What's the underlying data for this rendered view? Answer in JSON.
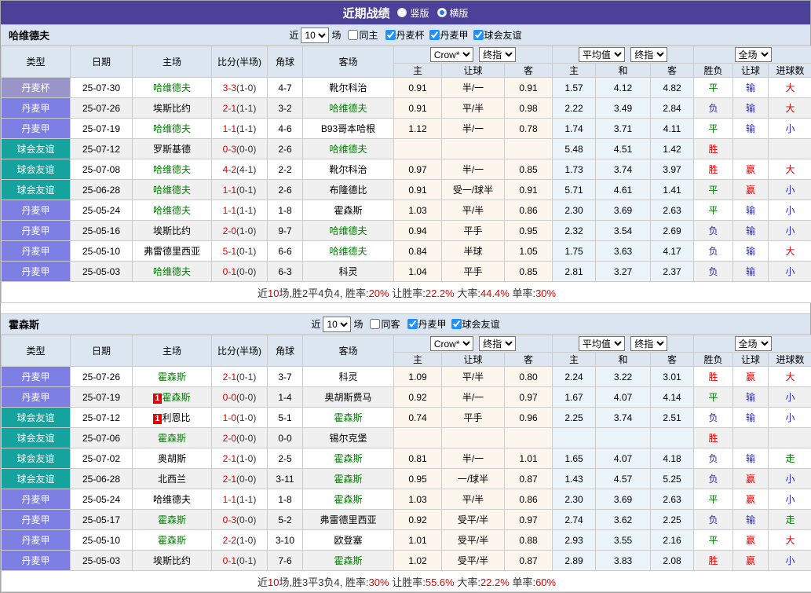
{
  "title_bar": {
    "title": "近期战绩",
    "radio_vertical": "竖版",
    "radio_horizontal": "横版",
    "selected": "横版"
  },
  "header_labels": {
    "type": "类型",
    "date": "日期",
    "home": "主场",
    "score": "比分(半场)",
    "corner": "角球",
    "away": "客场",
    "crow_select": "Crow*",
    "final_select": "终指",
    "avg_select": "平均值",
    "full_select": "全场",
    "odds_home": "主",
    "odds_handicap": "让球",
    "odds_away": "客",
    "avg_home": "主",
    "avg_draw": "和",
    "avg_away": "客",
    "result": "胜负",
    "handicap_result": "让球",
    "goals": "进球数"
  },
  "colors": {
    "accent_purple": "#4c4199",
    "cup": "#9a95c9",
    "league": "#7e7fe4",
    "friendly": "#15a3a0",
    "team_green": "#008000",
    "score_red": "#e00000",
    "loss_blue": "#2626d8"
  },
  "sections": [
    {
      "team": "哈维德夫",
      "filter": {
        "prefix": "近",
        "count": "10",
        "suffix": "场",
        "same_label": "同主",
        "same_checked": false,
        "leagues": [
          {
            "label": "丹麦杯",
            "checked": true
          },
          {
            "label": "丹麦甲",
            "checked": true
          },
          {
            "label": "球会友谊",
            "checked": true
          }
        ]
      },
      "rows": [
        {
          "type": "丹麦杯",
          "cls": "t-cup",
          "date": "25-07-30",
          "home": "哈维德夫",
          "hg": true,
          "hb": "",
          "score": "3-3",
          "half": "(1-0)",
          "corner": "4-7",
          "away": "靴尔科治",
          "ag": false,
          "ab": "",
          "crow": [
            "0.91",
            "半/一",
            "0.91"
          ],
          "avg": [
            "1.57",
            "4.12",
            "4.82"
          ],
          "res": [
            [
              "平",
              "g"
            ],
            [
              "输",
              "b"
            ],
            [
              "大",
              "r"
            ]
          ]
        },
        {
          "type": "丹麦甲",
          "cls": "t-league",
          "date": "25-07-26",
          "home": "埃斯比约",
          "hg": false,
          "hb": "",
          "score": "2-1",
          "half": "(1-1)",
          "corner": "3-2",
          "away": "哈维德夫",
          "ag": true,
          "ab": "",
          "crow": [
            "0.91",
            "平/半",
            "0.98"
          ],
          "avg": [
            "2.22",
            "3.49",
            "2.84"
          ],
          "res": [
            [
              "负",
              "b"
            ],
            [
              "输",
              "b"
            ],
            [
              "大",
              "r"
            ]
          ]
        },
        {
          "type": "丹麦甲",
          "cls": "t-league",
          "date": "25-07-19",
          "home": "哈维德夫",
          "hg": true,
          "hb": "",
          "score": "1-1",
          "half": "(1-1)",
          "corner": "4-6",
          "away": "B93哥本哈根",
          "ag": false,
          "ab": "",
          "crow": [
            "1.12",
            "半/一",
            "0.78"
          ],
          "avg": [
            "1.74",
            "3.71",
            "4.11"
          ],
          "res": [
            [
              "平",
              "g"
            ],
            [
              "输",
              "b"
            ],
            [
              "小",
              "b"
            ]
          ]
        },
        {
          "type": "球会友谊",
          "cls": "t-friendly",
          "date": "25-07-12",
          "home": "罗斯基德",
          "hg": false,
          "hb": "",
          "score": "0-3",
          "half": "(0-0)",
          "corner": "2-6",
          "away": "哈维德夫",
          "ag": true,
          "ab": "",
          "crow": [
            "",
            "",
            ""
          ],
          "avg": [
            "5.48",
            "4.51",
            "1.42"
          ],
          "res": [
            [
              "胜",
              "r"
            ],
            [
              "",
              ""
            ],
            [
              "",
              ""
            ]
          ]
        },
        {
          "type": "球会友谊",
          "cls": "t-friendly",
          "date": "25-07-08",
          "home": "哈维德夫",
          "hg": true,
          "hb": "",
          "score": "4-2",
          "half": "(4-1)",
          "corner": "2-2",
          "away": "靴尔科治",
          "ag": false,
          "ab": "",
          "crow": [
            "0.97",
            "半/一",
            "0.85"
          ],
          "avg": [
            "1.73",
            "3.74",
            "3.97"
          ],
          "res": [
            [
              "胜",
              "r"
            ],
            [
              "赢",
              "r"
            ],
            [
              "大",
              "r"
            ]
          ]
        },
        {
          "type": "球会友谊",
          "cls": "t-friendly",
          "date": "25-06-28",
          "home": "哈维德夫",
          "hg": true,
          "hb": "",
          "score": "1-1",
          "half": "(0-1)",
          "corner": "2-6",
          "away": "布隆德比",
          "ag": false,
          "ab": "",
          "crow": [
            "0.91",
            "受一/球半",
            "0.91"
          ],
          "avg": [
            "5.71",
            "4.61",
            "1.41"
          ],
          "res": [
            [
              "平",
              "g"
            ],
            [
              "赢",
              "r"
            ],
            [
              "小",
              "b"
            ]
          ]
        },
        {
          "type": "丹麦甲",
          "cls": "t-league",
          "date": "25-05-24",
          "home": "哈维德夫",
          "hg": true,
          "hb": "",
          "score": "1-1",
          "half": "(1-1)",
          "corner": "1-8",
          "away": "霍森斯",
          "ag": false,
          "ab": "",
          "crow": [
            "1.03",
            "平/半",
            "0.86"
          ],
          "avg": [
            "2.30",
            "3.69",
            "2.63"
          ],
          "res": [
            [
              "平",
              "g"
            ],
            [
              "输",
              "b"
            ],
            [
              "小",
              "b"
            ]
          ]
        },
        {
          "type": "丹麦甲",
          "cls": "t-league",
          "date": "25-05-16",
          "home": "埃斯比约",
          "hg": false,
          "hb": "",
          "score": "2-0",
          "half": "(1-0)",
          "corner": "9-7",
          "away": "哈维德夫",
          "ag": true,
          "ab": "",
          "crow": [
            "0.94",
            "平手",
            "0.95"
          ],
          "avg": [
            "2.32",
            "3.54",
            "2.69"
          ],
          "res": [
            [
              "负",
              "b"
            ],
            [
              "输",
              "b"
            ],
            [
              "小",
              "b"
            ]
          ]
        },
        {
          "type": "丹麦甲",
          "cls": "t-league",
          "date": "25-05-10",
          "home": "弗雷德里西亚",
          "hg": false,
          "hb": "",
          "score": "5-1",
          "half": "(0-1)",
          "corner": "6-6",
          "away": "哈维德夫",
          "ag": true,
          "ab": "",
          "crow": [
            "0.84",
            "半球",
            "1.05"
          ],
          "avg": [
            "1.75",
            "3.63",
            "4.17"
          ],
          "res": [
            [
              "负",
              "b"
            ],
            [
              "输",
              "b"
            ],
            [
              "大",
              "r"
            ]
          ]
        },
        {
          "type": "丹麦甲",
          "cls": "t-league",
          "date": "25-05-03",
          "home": "哈维德夫",
          "hg": true,
          "hb": "",
          "score": "0-1",
          "half": "(0-0)",
          "corner": "6-3",
          "away": "科灵",
          "ag": false,
          "ab": "",
          "crow": [
            "1.04",
            "平手",
            "0.85"
          ],
          "avg": [
            "2.81",
            "3.27",
            "2.37"
          ],
          "res": [
            [
              "负",
              "b"
            ],
            [
              "输",
              "b"
            ],
            [
              "小",
              "b"
            ]
          ]
        }
      ],
      "summary": [
        {
          "t": "近",
          "c": "k"
        },
        {
          "t": "10",
          "c": "r"
        },
        {
          "t": "场,胜2平4负4, 胜率:",
          "c": "k"
        },
        {
          "t": "20%",
          "c": "r"
        },
        {
          "t": " 让胜率:",
          "c": "k"
        },
        {
          "t": "22.2%",
          "c": "r"
        },
        {
          "t": " 大率:",
          "c": "k"
        },
        {
          "t": "44.4%",
          "c": "r"
        },
        {
          "t": " 单率:",
          "c": "k"
        },
        {
          "t": "30%",
          "c": "r"
        }
      ]
    },
    {
      "team": "霍森斯",
      "filter": {
        "prefix": "近",
        "count": "10",
        "suffix": "场",
        "same_label": "同客",
        "same_checked": false,
        "leagues": [
          {
            "label": "丹麦甲",
            "checked": true
          },
          {
            "label": "球会友谊",
            "checked": true
          }
        ]
      },
      "rows": [
        {
          "type": "丹麦甲",
          "cls": "t-league",
          "date": "25-07-26",
          "home": "霍森斯",
          "hg": true,
          "hb": "",
          "score": "2-1",
          "half": "(0-1)",
          "corner": "3-7",
          "away": "科灵",
          "ag": false,
          "ab": "",
          "crow": [
            "1.09",
            "平/半",
            "0.80"
          ],
          "avg": [
            "2.24",
            "3.22",
            "3.01"
          ],
          "res": [
            [
              "胜",
              "r"
            ],
            [
              "赢",
              "r"
            ],
            [
              "大",
              "r"
            ]
          ]
        },
        {
          "type": "丹麦甲",
          "cls": "t-league",
          "date": "25-07-19",
          "home": "霍森斯",
          "hg": true,
          "hb": "1",
          "score": "0-0",
          "half": "(0-0)",
          "corner": "1-4",
          "away": "奥胡斯费马",
          "ag": false,
          "ab": "",
          "crow": [
            "0.92",
            "半/一",
            "0.97"
          ],
          "avg": [
            "1.67",
            "4.07",
            "4.14"
          ],
          "res": [
            [
              "平",
              "g"
            ],
            [
              "输",
              "b"
            ],
            [
              "小",
              "b"
            ]
          ]
        },
        {
          "type": "球会友谊",
          "cls": "t-friendly",
          "date": "25-07-12",
          "home": "利恩比",
          "hg": false,
          "hb": "1",
          "score": "1-0",
          "half": "(1-0)",
          "corner": "5-1",
          "away": "霍森斯",
          "ag": true,
          "ab": "",
          "crow": [
            "0.74",
            "平手",
            "0.96"
          ],
          "avg": [
            "2.25",
            "3.74",
            "2.51"
          ],
          "res": [
            [
              "负",
              "b"
            ],
            [
              "输",
              "b"
            ],
            [
              "小",
              "b"
            ]
          ]
        },
        {
          "type": "球会友谊",
          "cls": "t-friendly",
          "date": "25-07-06",
          "home": "霍森斯",
          "hg": true,
          "hb": "",
          "score": "2-0",
          "half": "(0-0)",
          "corner": "0-0",
          "away": "锡尔克堡",
          "ag": false,
          "ab": "",
          "crow": [
            "",
            "",
            ""
          ],
          "avg": [
            "",
            "",
            ""
          ],
          "res": [
            [
              "胜",
              "r"
            ],
            [
              "",
              ""
            ],
            [
              "",
              ""
            ]
          ]
        },
        {
          "type": "球会友谊",
          "cls": "t-friendly",
          "date": "25-07-02",
          "home": "奥胡斯",
          "hg": false,
          "hb": "",
          "score": "2-1",
          "half": "(1-0)",
          "corner": "2-5",
          "away": "霍森斯",
          "ag": true,
          "ab": "",
          "crow": [
            "0.81",
            "半/一",
            "1.01"
          ],
          "avg": [
            "1.65",
            "4.07",
            "4.18"
          ],
          "res": [
            [
              "负",
              "b"
            ],
            [
              "输",
              "b"
            ],
            [
              "走",
              "g"
            ]
          ]
        },
        {
          "type": "球会友谊",
          "cls": "t-friendly",
          "date": "25-06-28",
          "home": "北西兰",
          "hg": false,
          "hb": "",
          "score": "2-1",
          "half": "(0-0)",
          "corner": "3-11",
          "away": "霍森斯",
          "ag": true,
          "ab": "",
          "crow": [
            "0.95",
            "一/球半",
            "0.87"
          ],
          "avg": [
            "1.43",
            "4.57",
            "5.25"
          ],
          "res": [
            [
              "负",
              "b"
            ],
            [
              "赢",
              "r"
            ],
            [
              "小",
              "b"
            ]
          ]
        },
        {
          "type": "丹麦甲",
          "cls": "t-league",
          "date": "25-05-24",
          "home": "哈维德夫",
          "hg": false,
          "hb": "",
          "score": "1-1",
          "half": "(1-1)",
          "corner": "1-8",
          "away": "霍森斯",
          "ag": true,
          "ab": "",
          "crow": [
            "1.03",
            "平/半",
            "0.86"
          ],
          "avg": [
            "2.30",
            "3.69",
            "2.63"
          ],
          "res": [
            [
              "平",
              "g"
            ],
            [
              "赢",
              "r"
            ],
            [
              "小",
              "b"
            ]
          ]
        },
        {
          "type": "丹麦甲",
          "cls": "t-league",
          "date": "25-05-17",
          "home": "霍森斯",
          "hg": true,
          "hb": "",
          "score": "0-3",
          "half": "(0-0)",
          "corner": "5-2",
          "away": "弗雷德里西亚",
          "ag": false,
          "ab": "",
          "crow": [
            "0.92",
            "受平/半",
            "0.97"
          ],
          "avg": [
            "2.74",
            "3.62",
            "2.25"
          ],
          "res": [
            [
              "负",
              "b"
            ],
            [
              "输",
              "b"
            ],
            [
              "走",
              "g"
            ]
          ]
        },
        {
          "type": "丹麦甲",
          "cls": "t-league",
          "date": "25-05-10",
          "home": "霍森斯",
          "hg": true,
          "hb": "",
          "score": "2-2",
          "half": "(1-0)",
          "corner": "3-10",
          "away": "欧登塞",
          "ag": false,
          "ab": "",
          "crow": [
            "1.01",
            "受平/半",
            "0.88"
          ],
          "avg": [
            "2.93",
            "3.55",
            "2.16"
          ],
          "res": [
            [
              "平",
              "g"
            ],
            [
              "赢",
              "r"
            ],
            [
              "大",
              "r"
            ]
          ]
        },
        {
          "type": "丹麦甲",
          "cls": "t-league",
          "date": "25-05-03",
          "home": "埃斯比约",
          "hg": false,
          "hb": "",
          "score": "0-1",
          "half": "(0-1)",
          "corner": "7-6",
          "away": "霍森斯",
          "ag": true,
          "ab": "",
          "crow": [
            "1.02",
            "受平/半",
            "0.87"
          ],
          "avg": [
            "2.89",
            "3.83",
            "2.08"
          ],
          "res": [
            [
              "胜",
              "r"
            ],
            [
              "赢",
              "r"
            ],
            [
              "小",
              "b"
            ]
          ]
        }
      ],
      "summary": [
        {
          "t": "近",
          "c": "k"
        },
        {
          "t": "10",
          "c": "r"
        },
        {
          "t": "场,胜3平3负4, 胜率:",
          "c": "k"
        },
        {
          "t": "30%",
          "c": "r"
        },
        {
          "t": " 让胜率:",
          "c": "k"
        },
        {
          "t": "55.6%",
          "c": "r"
        },
        {
          "t": " 大率:",
          "c": "k"
        },
        {
          "t": "22.2%",
          "c": "r"
        },
        {
          "t": " 单率:",
          "c": "k"
        },
        {
          "t": "60%",
          "c": "r"
        }
      ]
    }
  ]
}
